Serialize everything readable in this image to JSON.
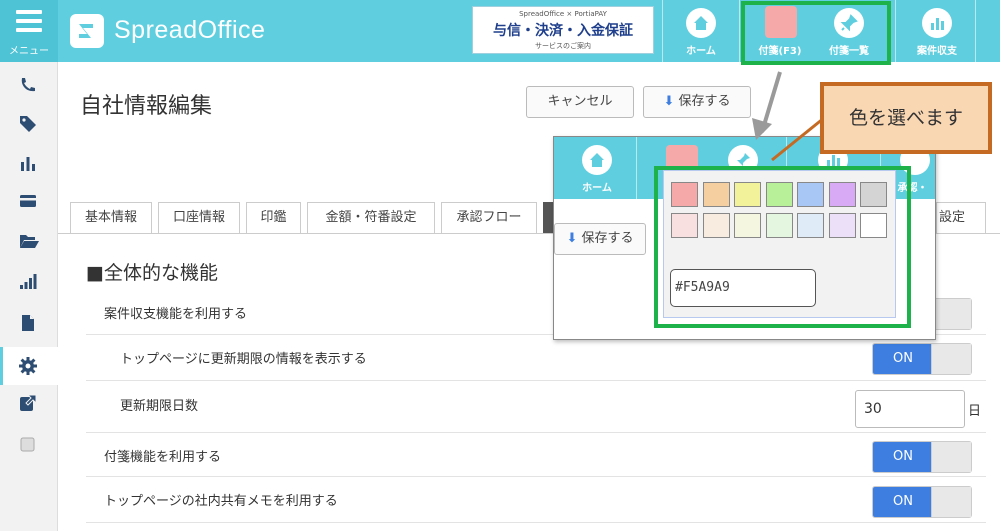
{
  "header": {
    "menu_label": "メニュー",
    "logo_text": "SpreadOffice",
    "banner": {
      "small_text": "SpreadOffice × PortiaPAY",
      "title": "与信・決済・入金保証",
      "subtitle": "サービスのご案内"
    },
    "nav": [
      {
        "label": "ホーム",
        "icon": "home-icon"
      },
      {
        "label": "付箋(F3)",
        "icon": "sticky-note-color-swatch"
      },
      {
        "label": "付箋一覧",
        "icon": "pushpin-icon"
      },
      {
        "label": "案件収支",
        "icon": "bar-chart-icon"
      }
    ]
  },
  "sidebar": {
    "items": [
      {
        "icon": "phone-icon"
      },
      {
        "icon": "tags-icon"
      },
      {
        "icon": "bar-chart-icon"
      },
      {
        "icon": "credit-card-icon"
      },
      {
        "icon": "folder-open-icon"
      },
      {
        "icon": "signal-icon"
      },
      {
        "icon": "file-icon"
      },
      {
        "icon": "gear-icon"
      },
      {
        "icon": "external-link-icon"
      },
      {
        "icon": "checkbox-icon"
      }
    ]
  },
  "page": {
    "title": "自社情報編集",
    "cancel_label": "キャンセル",
    "save_label": "保存する"
  },
  "tabs": [
    "基本情報",
    "口座情報",
    "印鑑",
    "金額・符番設定",
    "承認フロー",
    "設定"
  ],
  "section": {
    "title": "■全体的な機能",
    "rows": [
      {
        "label": "案件収支機能を利用する"
      },
      {
        "label": "トップページに更新期限の情報を表示する",
        "toggle": "ON"
      },
      {
        "label": "更新期限日数",
        "value": "30",
        "unit": "日"
      },
      {
        "label": "付箋機能を利用する",
        "toggle": "ON"
      },
      {
        "label": "トップページの社内共有メモを利用する",
        "toggle": "ON"
      }
    ]
  },
  "popup": {
    "nav": [
      {
        "label": "ホーム",
        "icon": "home-icon"
      },
      {
        "label": "",
        "icon": "sticky-note-color-swatch"
      },
      {
        "label": "",
        "icon": "pushpin-icon"
      },
      {
        "label": "",
        "icon": "bar-chart-icon"
      },
      {
        "label": "承認・",
        "icon": "approve-icon"
      }
    ],
    "save_label": "保存する",
    "hex_value": "#F5A9A9",
    "swatches_row1": [
      "#f5a9a9",
      "#f5cfa0",
      "#f2f29a",
      "#b8f09a",
      "#a9c7f5",
      "#d8a9f5",
      "#d4d4d4"
    ],
    "swatches_row2": [
      "#f8e0e0",
      "#f8ece0",
      "#f4f6e0",
      "#e4f5e0",
      "#e0ebf8",
      "#ece0f8",
      "#ffffff"
    ]
  },
  "callout": {
    "text": "色を選べます"
  },
  "colors": {
    "header_bg": "#5fcfe0",
    "highlight_green": "#1eb34a",
    "callout_border": "#c56a22",
    "callout_bg": "#fad7b3",
    "toggle_on": "#3d7ee0",
    "selected_color": "#f5a9a9"
  }
}
